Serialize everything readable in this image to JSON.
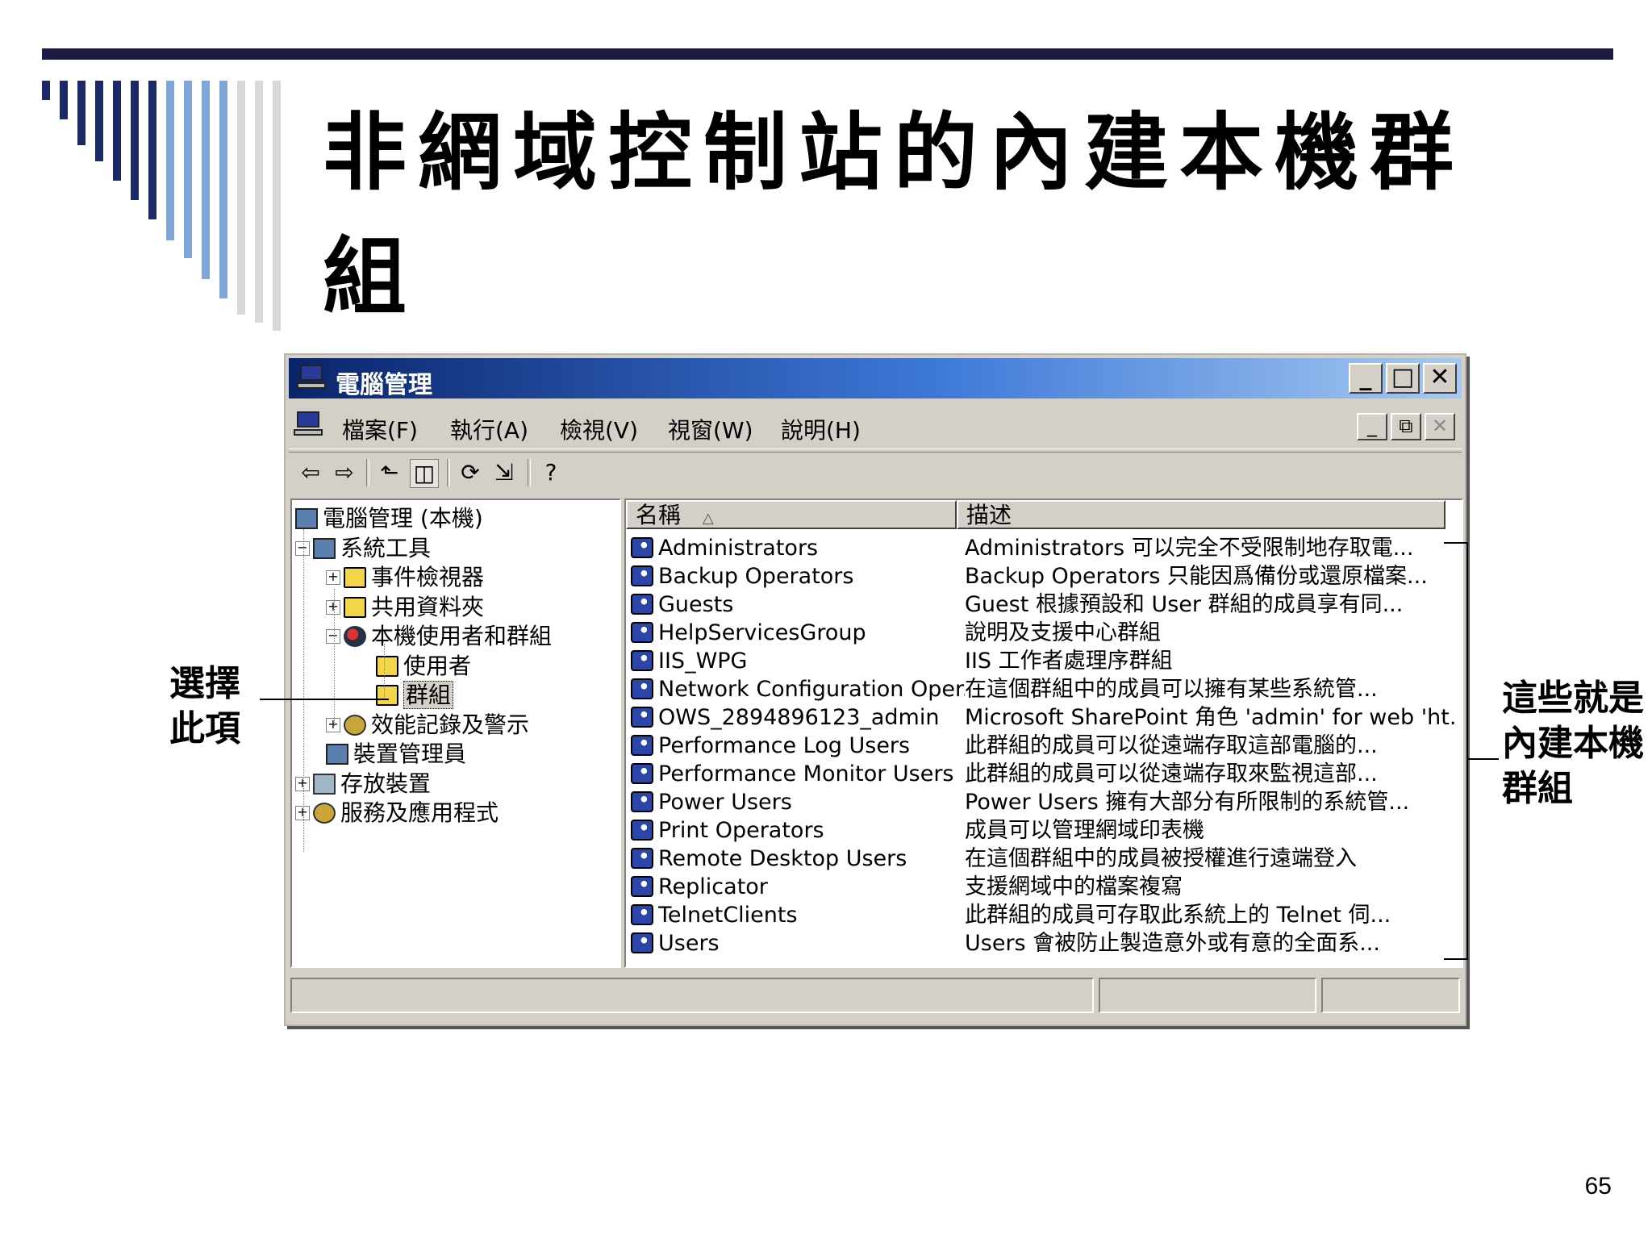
{
  "slide": {
    "title": "非網域控制站的內建本機群組",
    "page_number": "65"
  },
  "window": {
    "title": "電腦管理",
    "menu": [
      "檔案(F)",
      "執行(A)",
      "檢視(V)",
      "視窗(W)",
      "說明(H)"
    ],
    "caption_buttons": {
      "minimize": "_",
      "maximize": "□",
      "close": "✕"
    },
    "mdi_buttons": {
      "minimize": "_",
      "restore": "⧉",
      "close": "✕"
    },
    "toolbar_icons": [
      "back-arrow-icon",
      "forward-arrow-icon",
      "up-folder-icon",
      "show-hide-tree-icon",
      "refresh-icon",
      "export-list-icon",
      "help-icon"
    ],
    "toolbar_glyphs": {
      "back": "⇦",
      "forward": "⇨",
      "up": "⬑",
      "tree": "◫",
      "refresh": "⟳",
      "export": "⇲",
      "help": "?"
    },
    "tree": [
      {
        "label": "電腦管理 (本機)",
        "level": 0
      },
      {
        "label": "系統工具",
        "level": 1,
        "expander": "−"
      },
      {
        "label": "事件檢視器",
        "level": 2,
        "expander": "+"
      },
      {
        "label": "共用資料夾",
        "level": 2,
        "expander": "+"
      },
      {
        "label": "本機使用者和群組",
        "level": 2,
        "expander": "−"
      },
      {
        "label": "使用者",
        "level": 3
      },
      {
        "label": "群組",
        "level": 3,
        "selected": true
      },
      {
        "label": "效能記錄及警示",
        "level": 2,
        "expander": "+"
      },
      {
        "label": "裝置管理員",
        "level": 2
      },
      {
        "label": "存放裝置",
        "level": 1,
        "expander": "+"
      },
      {
        "label": "服務及應用程式",
        "level": 1,
        "expander": "+"
      }
    ],
    "columns": {
      "name": "名稱",
      "sort_indicator": "△",
      "description": "描述"
    },
    "groups": [
      {
        "name": "Administrators",
        "description": "Administrators 可以完全不受限制地存取電..."
      },
      {
        "name": "Backup Operators",
        "description": "Backup Operators 只能因爲備份或還原檔案..."
      },
      {
        "name": "Guests",
        "description": "Guest 根據預設和 User 群組的成員享有同..."
      },
      {
        "name": "HelpServicesGroup",
        "description": "說明及支援中心群組"
      },
      {
        "name": "IIS_WPG",
        "description": "IIS 工作者處理序群組"
      },
      {
        "name": "Network Configuration Oper...",
        "description": "在這個群組中的成員可以擁有某些系統管..."
      },
      {
        "name": "OWS_2894896123_admin",
        "description": "Microsoft SharePoint 角色 'admin' for web 'ht..."
      },
      {
        "name": "Performance Log Users",
        "description": "此群組的成員可以從遠端存取這部電腦的..."
      },
      {
        "name": "Performance Monitor Users",
        "description": "此群組的成員可以從遠端存取來監視這部..."
      },
      {
        "name": "Power Users",
        "description": "Power Users 擁有大部分有所限制的系統管..."
      },
      {
        "name": "Print Operators",
        "description": "成員可以管理網域印表機"
      },
      {
        "name": "Remote Desktop Users",
        "description": "在這個群組中的成員被授權進行遠端登入"
      },
      {
        "name": "Replicator",
        "description": "支援網域中的檔案複寫"
      },
      {
        "name": "TelnetClients",
        "description": "此群組的成員可存取此系統上的 Telnet 伺..."
      },
      {
        "name": "Users",
        "description": "Users 會被防止製造意外或有意的全面系..."
      }
    ]
  },
  "annotations": {
    "left_line1": "選擇",
    "left_line2": "此項",
    "right_line1": "這些就是",
    "right_line2": "內建本機",
    "right_line3": "群組"
  },
  "colors": {
    "title_bar_start": "#0a246a",
    "title_bar_end": "#a6caf0",
    "slide_bar": "#1b1b44",
    "stripe_dark": "#1b2a66",
    "stripe_mid": "#7fa6d6",
    "stripe_light": "#d8d8d8"
  }
}
